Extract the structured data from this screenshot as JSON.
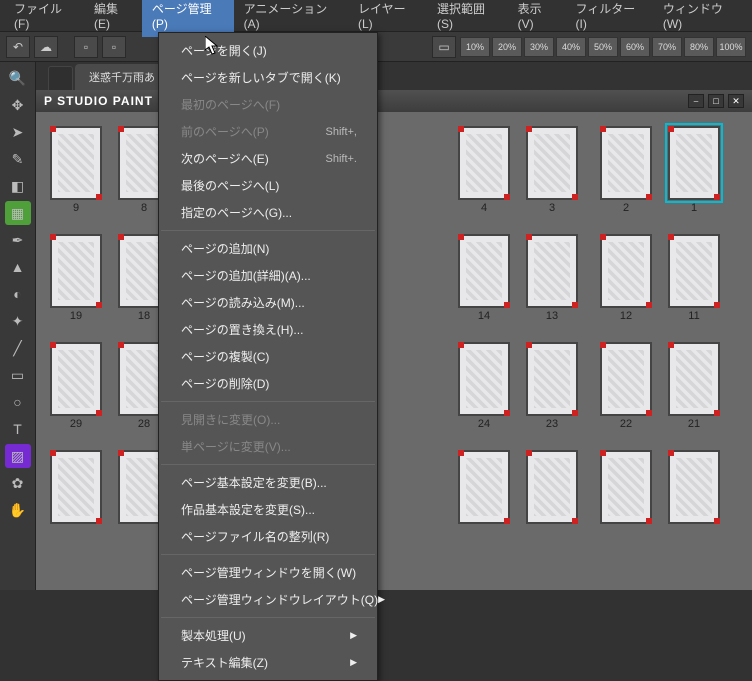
{
  "menubar": {
    "items": [
      {
        "label": "ファイル(F)"
      },
      {
        "label": "編集(E)"
      },
      {
        "label": "ページ管理(P)",
        "active": true
      },
      {
        "label": "アニメーション(A)"
      },
      {
        "label": "レイヤー(L)"
      },
      {
        "label": "選択範囲(S)"
      },
      {
        "label": "表示(V)"
      },
      {
        "label": "フィルター(I)"
      },
      {
        "label": "ウィンドウ(W)"
      }
    ]
  },
  "toolbar": {
    "zoom_levels": [
      "10%",
      "20%",
      "30%",
      "40%",
      "50%",
      "60%",
      "70%",
      "80%",
      "100%"
    ]
  },
  "tab": {
    "label": "迷惑千万雨あ"
  },
  "panel": {
    "title": "P STUDIO PAINT EX",
    "minimize": "⎯",
    "maximize": "□",
    "close": "✕"
  },
  "dropdown": {
    "items": [
      {
        "label": "ページを開く(J)",
        "type": "item"
      },
      {
        "label": "ページを新しいタブで開く(K)",
        "type": "item"
      },
      {
        "label": "最初のページへ(F)",
        "type": "item",
        "disabled": true
      },
      {
        "label": "前のページへ(P)",
        "shortcut": "Shift+,",
        "type": "item",
        "disabled": true
      },
      {
        "label": "次のページへ(E)",
        "shortcut": "Shift+.",
        "type": "item"
      },
      {
        "label": "最後のページへ(L)",
        "type": "item"
      },
      {
        "label": "指定のページへ(G)...",
        "type": "item"
      },
      {
        "type": "sep"
      },
      {
        "label": "ページの追加(N)",
        "type": "item"
      },
      {
        "label": "ページの追加(詳細)(A)...",
        "type": "item"
      },
      {
        "label": "ページの読み込み(M)...",
        "type": "item"
      },
      {
        "label": "ページの置き換え(H)...",
        "type": "item"
      },
      {
        "label": "ページの複製(C)",
        "type": "item"
      },
      {
        "label": "ページの削除(D)",
        "type": "item"
      },
      {
        "type": "sep"
      },
      {
        "label": "見開きに変更(O)...",
        "type": "item",
        "disabled": true
      },
      {
        "label": "単ページに変更(V)...",
        "type": "item",
        "disabled": true
      },
      {
        "type": "sep"
      },
      {
        "label": "ページ基本設定を変更(B)...",
        "type": "item"
      },
      {
        "label": "作品基本設定を変更(S)...",
        "type": "item"
      },
      {
        "label": "ページファイル名の整列(R)",
        "type": "item"
      },
      {
        "type": "sep"
      },
      {
        "label": "ページ管理ウィンドウを開く(W)",
        "type": "item"
      },
      {
        "label": "ページ管理ウィンドウレイアウト(Q)",
        "type": "submenu"
      },
      {
        "type": "sep"
      },
      {
        "label": "製本処理(U)",
        "type": "submenu"
      },
      {
        "label": "テキスト編集(Z)",
        "type": "submenu"
      }
    ]
  },
  "thumbnails": {
    "rows": [
      [
        9,
        8,
        "",
        "",
        "",
        "",
        4,
        3,
        2,
        1
      ],
      [
        19,
        18,
        "",
        "",
        "",
        "",
        14,
        13,
        12,
        11
      ],
      [
        29,
        28,
        "",
        "",
        "",
        "",
        24,
        23,
        22,
        21
      ],
      [
        "",
        "",
        "",
        "",
        "",
        "",
        "",
        "",
        "",
        ""
      ]
    ],
    "hidden_cols": [
      2,
      3,
      4,
      5
    ],
    "right_shift_cols": [
      8,
      9
    ],
    "selected": {
      "row": 0,
      "col": 9
    }
  }
}
